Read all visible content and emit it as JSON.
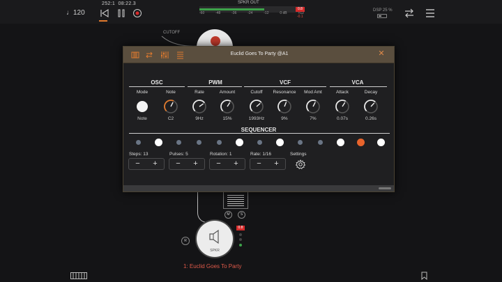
{
  "topbar": {
    "tempo": "♩120",
    "position": "252:1",
    "time": "08:22.3",
    "meter_title": "SPKR OUT",
    "meter_scale": [
      "-60",
      "-48",
      "-36",
      "-24",
      "-12",
      "0 dB",
      "+12"
    ],
    "clip_badge": "0.8",
    "peak_value": "-0.1",
    "meter_level": 0.62,
    "dsp": "DSP 25 %"
  },
  "canvas": {
    "cutoff_label": "CUTOFF",
    "mute_label": "M",
    "solo_label": "S",
    "record_label": "R",
    "node_label": "SPKR",
    "node_clip": "0.8",
    "track_name": "1: Euclid Goes To Party"
  },
  "panel": {
    "title": "Euclid Goes To Party @A1",
    "sections": {
      "osc": "OSC",
      "pwm": "PWM",
      "vcf": "VCF",
      "vca": "VCA"
    },
    "params": [
      {
        "label": "Mode",
        "value": "Note",
        "kind": "toggle"
      },
      {
        "label": "Note",
        "value": "C2",
        "kind": "knob",
        "level": 0.6,
        "accent": true
      },
      {
        "label": "Rate",
        "value": "9Hz",
        "kind": "knob",
        "level": 0.7
      },
      {
        "label": "Amount",
        "value": "15%",
        "kind": "knob",
        "level": 0.62
      },
      {
        "label": "Cutoff",
        "value": "1993Hz",
        "kind": "knob",
        "level": 0.68
      },
      {
        "label": "Resonance",
        "value": "9%",
        "kind": "knob",
        "level": 0.58
      },
      {
        "label": "Mod Amt",
        "value": "7%",
        "kind": "knob",
        "level": 0.6
      },
      {
        "label": "Attack",
        "value": "0.07s",
        "kind": "knob",
        "level": 0.62
      },
      {
        "label": "Decay",
        "value": "0.26s",
        "kind": "knob",
        "level": 0.66
      }
    ],
    "sequencer": {
      "title": "SEQUENCER",
      "steps": [
        "off",
        "on",
        "off",
        "off",
        "off",
        "on",
        "off",
        "on",
        "off",
        "off",
        "on",
        "current",
        "on"
      ]
    },
    "controls": {
      "steps_label": "Steps: 13",
      "pulses_label": "Pulses: 5",
      "rotation_label": "Rotation: 1",
      "rate_label": "Rate: 1/16",
      "settings_label": "Settings",
      "minus": "−",
      "plus": "+"
    }
  },
  "colors": {
    "accent": "#e07a2e",
    "header": "#5a4e3e",
    "step_on": "#ffffff",
    "step_off": "#6a7585",
    "step_current": "#e8642c",
    "meter_green": "#3da34a",
    "clip_red": "#d62b2b"
  }
}
